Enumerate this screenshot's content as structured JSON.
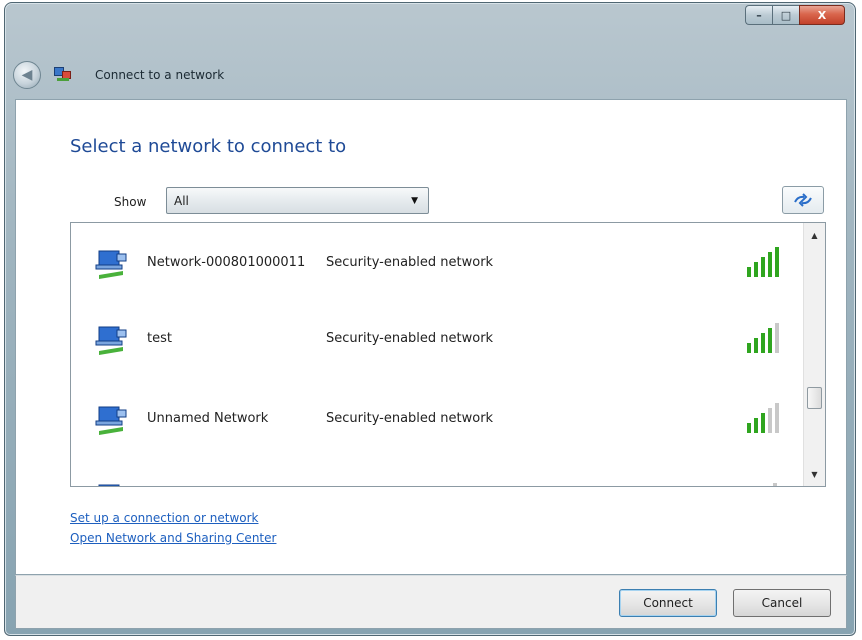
{
  "window": {
    "title": "Connect to a network",
    "controls": {
      "minimize": "–",
      "maximize": "□",
      "close": "X"
    }
  },
  "heading": "Select a network to connect to",
  "filter": {
    "label": "Show",
    "selected": "All"
  },
  "networks": [
    {
      "name": "Network-000801000011",
      "security": "Security-enabled network",
      "signal_bars": 5
    },
    {
      "name": "test",
      "security": "Security-enabled network",
      "signal_bars": 4
    },
    {
      "name": "Unnamed Network",
      "security": "Security-enabled network",
      "signal_bars": 3
    }
  ],
  "links": {
    "setup": "Set up a connection or network",
    "sharing_center": "Open Network and Sharing Center"
  },
  "buttons": {
    "connect": "Connect",
    "cancel": "Cancel"
  },
  "colors": {
    "heading": "#1f4a96",
    "link": "#1d5fbf",
    "signal_active": "#2fa51f",
    "signal_inactive": "#c8c8c8"
  }
}
